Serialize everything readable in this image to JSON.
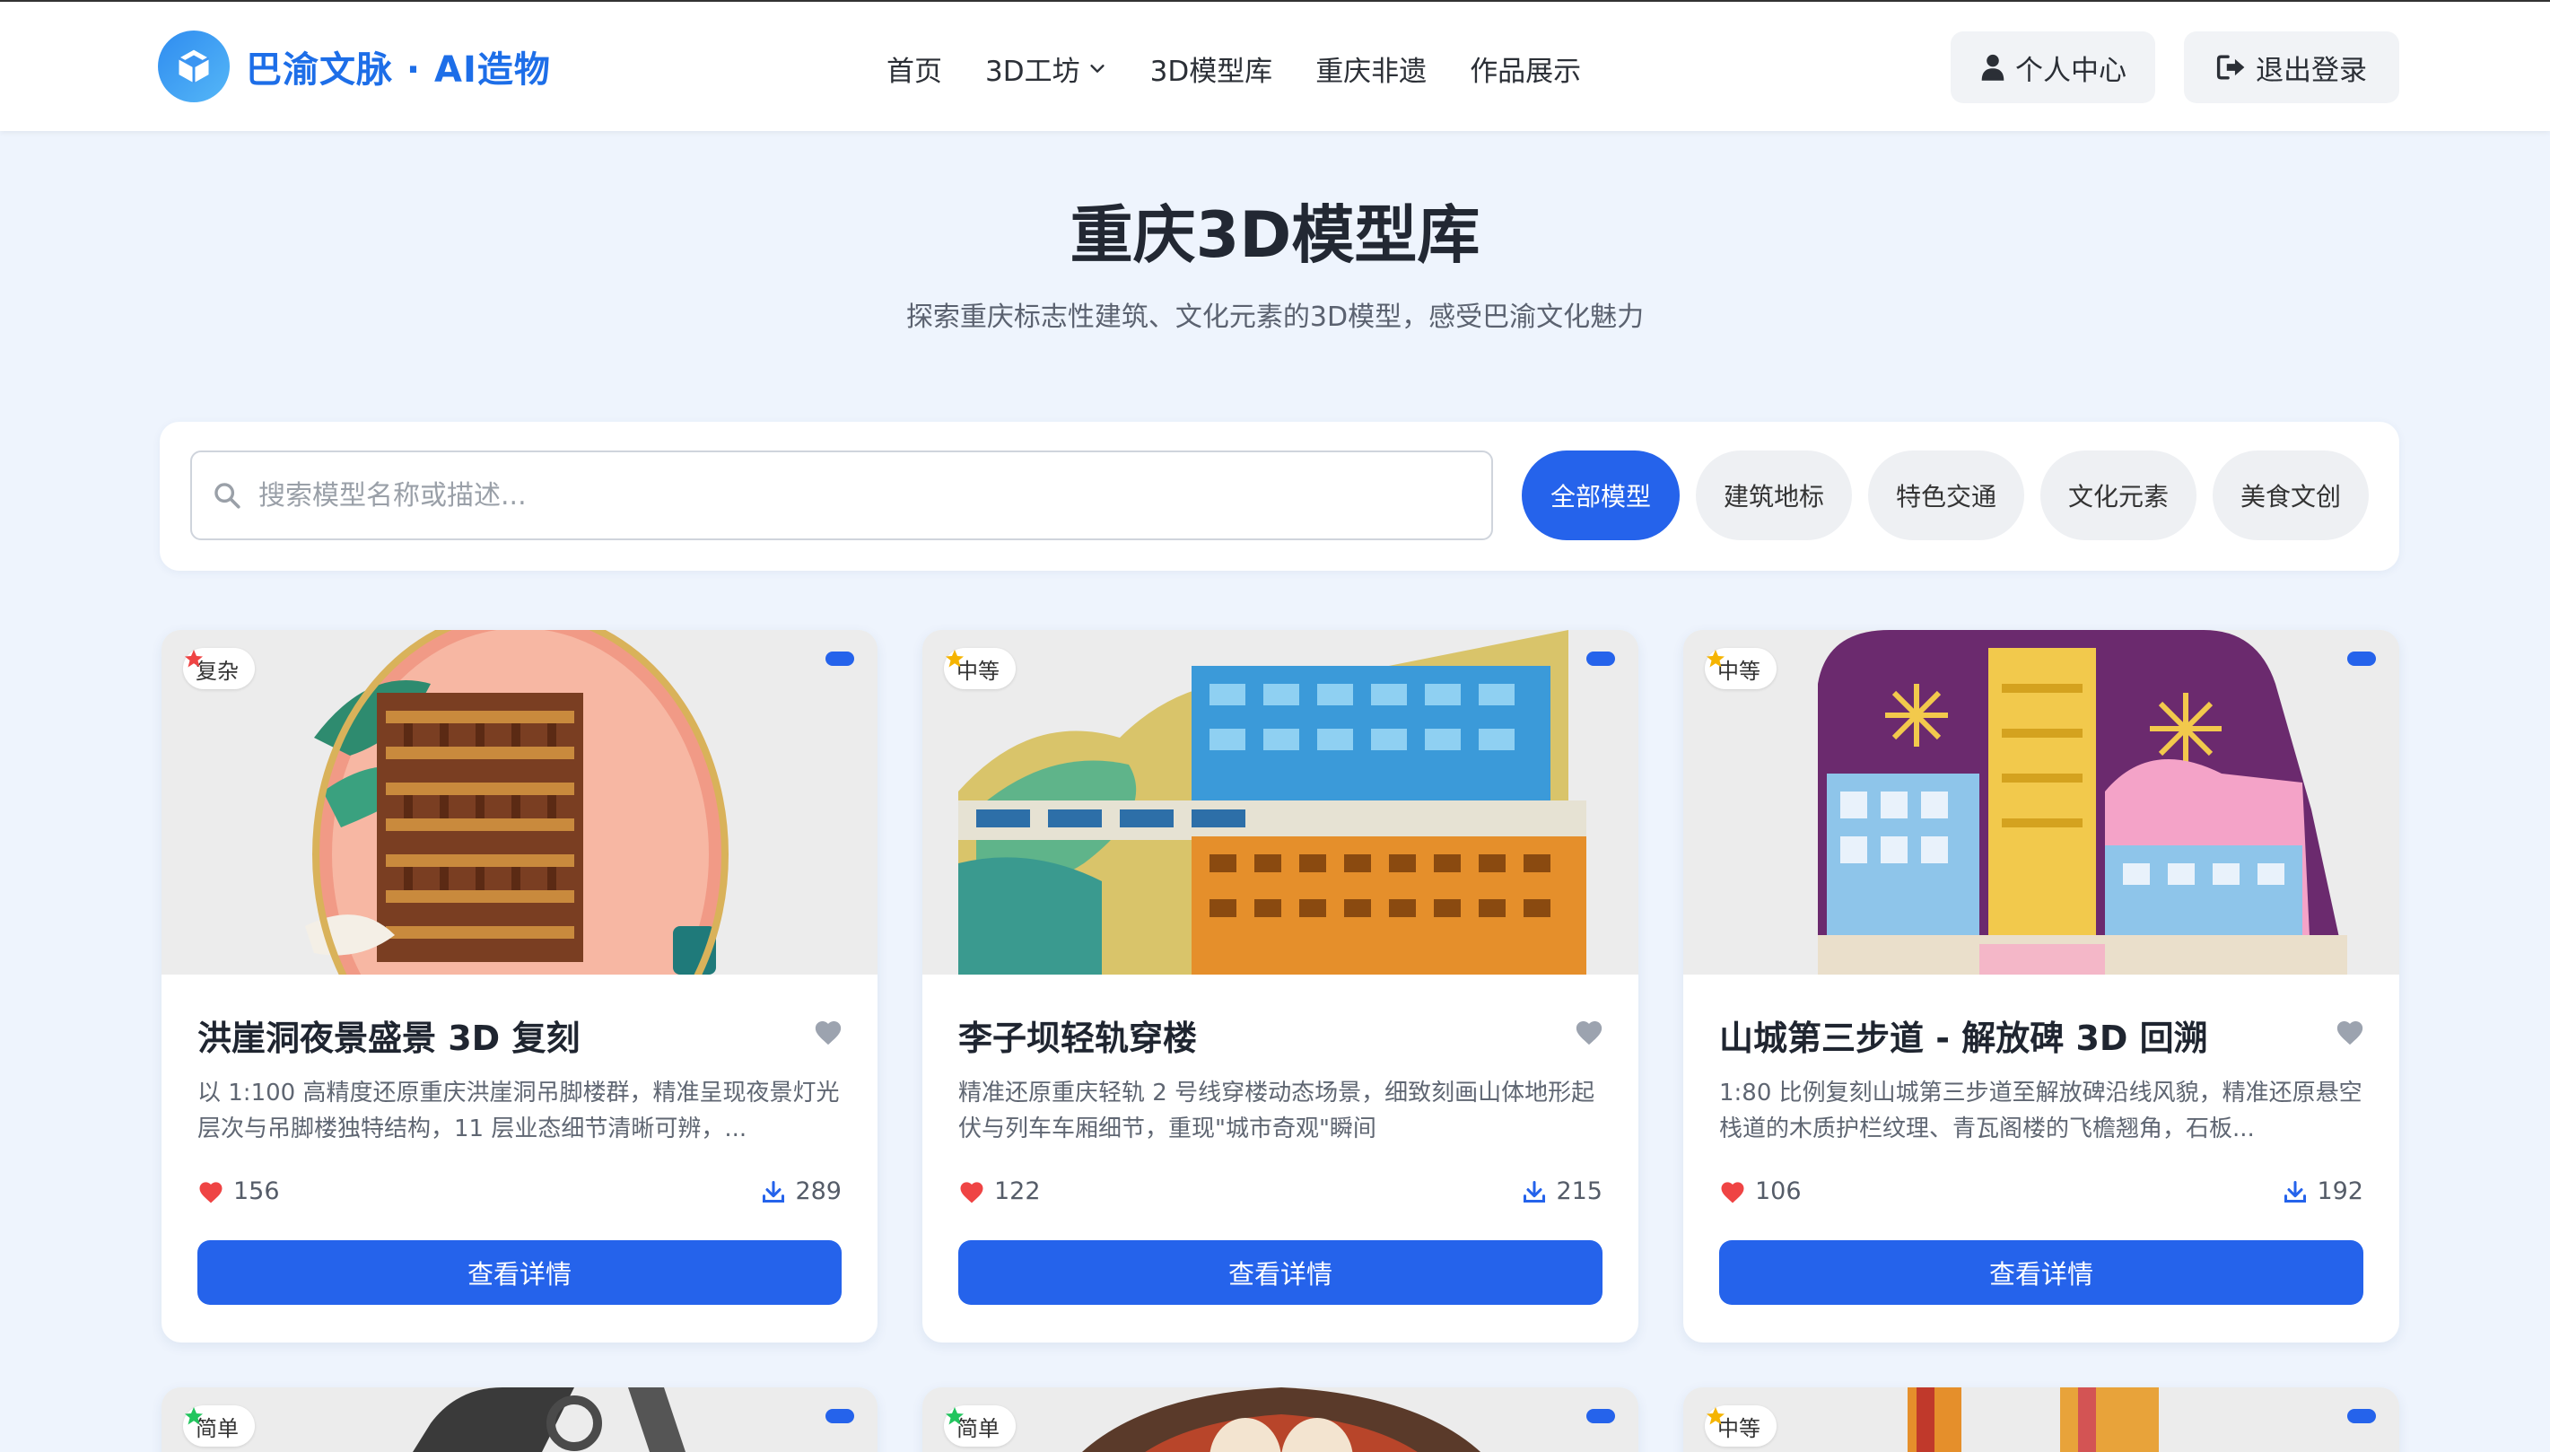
{
  "brand": {
    "name": "巴渝文脉 · AI造物"
  },
  "nav": {
    "items": [
      "首页",
      "3D工坊",
      "3D模型库",
      "重庆非遗",
      "作品展示"
    ]
  },
  "header_actions": {
    "profile": "个人中心",
    "logout": "退出登录"
  },
  "hero": {
    "title": "重庆3D模型库",
    "subtitle": "探索重庆标志性建筑、文化元素的3D模型，感受巴渝文化魅力"
  },
  "search": {
    "placeholder": "搜索模型名称或描述..."
  },
  "filters": {
    "chips": [
      "全部模型",
      "建筑地标",
      "特色交通",
      "文化元素",
      "美食文创"
    ],
    "active": "全部模型"
  },
  "colors": {
    "accent": "#2563eb",
    "like": "#ef4444",
    "star_complex": "#ef4444",
    "star_medium": "#f5b400",
    "star_easy": "#22c55e"
  },
  "cards": [
    {
      "difficulty": "复杂",
      "title": "洪崖洞夜景盛景 3D 复刻",
      "desc": "以 1:100 高精度还原重庆洪崖洞吊脚楼群，精准呈现夜景灯光层次与吊脚楼独特结构，11 层业态细节清晰可辨，...",
      "likes": "156",
      "downloads": "289",
      "button": "查看详情"
    },
    {
      "difficulty": "中等",
      "title": "李子坝轻轨穿楼",
      "desc": "精准还原重庆轻轨 2 号线穿楼动态场景，细致刻画山体地形起伏与列车车厢细节，重现\"城市奇观\"瞬间",
      "likes": "122",
      "downloads": "215",
      "button": "查看详情"
    },
    {
      "difficulty": "中等",
      "title": "山城第三步道 - 解放碑 3D 回溯",
      "desc": "1:80 比例复刻山城第三步道至解放碑沿线风貌，精准还原悬空栈道的木质护栏纹理、青瓦阁楼的飞檐翘角，石板...",
      "likes": "106",
      "downloads": "192",
      "button": "查看详情"
    }
  ],
  "cards_row2": [
    {
      "difficulty": "简单"
    },
    {
      "difficulty": "简单"
    },
    {
      "difficulty": "中等"
    }
  ]
}
